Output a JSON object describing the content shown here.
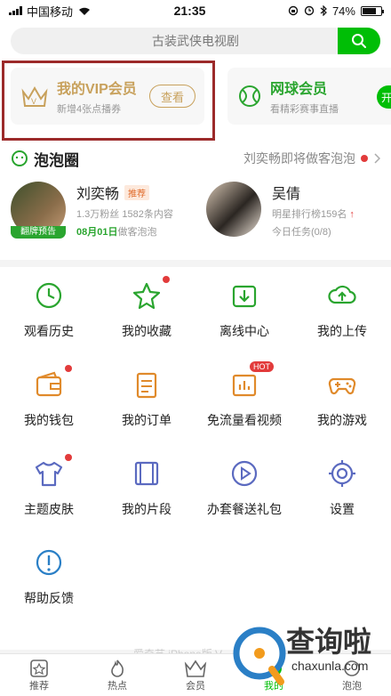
{
  "status_bar": {
    "carrier": "中国移动",
    "time": "21:35",
    "battery": "74%",
    "battery_level": 0.74
  },
  "search": {
    "placeholder": "古装武侠电视剧",
    "icon": "search-icon"
  },
  "vip": {
    "title": "我的VIP会员",
    "subtitle": "新增4张点播券",
    "view_button": "查看"
  },
  "tennis": {
    "title": "网球会员",
    "subtitle": "看精彩赛事直播",
    "open_button": "开"
  },
  "paopao": {
    "title": "泡泡圈",
    "notice": "刘奕畅即将做客泡泡",
    "stars": [
      {
        "name": "刘奕畅",
        "tag": "推荐",
        "stats": "1.3万粉丝 1582条内容",
        "date": "08月01日",
        "event": "做客泡泡",
        "badge": "翻牌预告"
      },
      {
        "name": "吴倩",
        "stats": "明星排行榜159名",
        "task": "今日任务(0/8)"
      }
    ]
  },
  "grid": [
    {
      "label": "观看历史",
      "icon": "history-clock-icon"
    },
    {
      "label": "我的收藏",
      "icon": "favorite-star-icon"
    },
    {
      "label": "离线中心",
      "icon": "download-icon"
    },
    {
      "label": "我的上传",
      "icon": "upload-cloud-icon"
    },
    {
      "label": "我的钱包",
      "icon": "wallet-icon"
    },
    {
      "label": "我的订单",
      "icon": "order-list-icon"
    },
    {
      "label": "免流量看视频",
      "icon": "data-free-video-icon",
      "badge": "HOT"
    },
    {
      "label": "我的游戏",
      "icon": "gamepad-icon"
    },
    {
      "label": "主题皮肤",
      "icon": "tshirt-icon"
    },
    {
      "label": "我的片段",
      "icon": "film-clip-icon"
    },
    {
      "label": "办套餐送礼包",
      "icon": "play-circle-icon"
    },
    {
      "label": "设置",
      "icon": "settings-gear-icon"
    },
    {
      "label": "帮助反馈",
      "icon": "help-icon"
    }
  ],
  "footer_text": "爱奇艺 iPhone版 V",
  "tabs": [
    {
      "label": "推荐",
      "icon": "recommend-icon"
    },
    {
      "label": "热点",
      "icon": "flame-icon"
    },
    {
      "label": "会员",
      "icon": "vip-crown-icon"
    },
    {
      "label": "我的",
      "icon": "my-profile-icon",
      "active": true
    },
    {
      "label": "泡泡",
      "icon": "bubble-icon"
    }
  ],
  "watermark": {
    "title": "查询啦",
    "sub": "chaxunla.com"
  },
  "colors": {
    "brand_green": "#00be06",
    "vip_gold": "#c8a15c",
    "highlight_red": "#9c2a2a",
    "alert_red": "#e23b3b"
  }
}
